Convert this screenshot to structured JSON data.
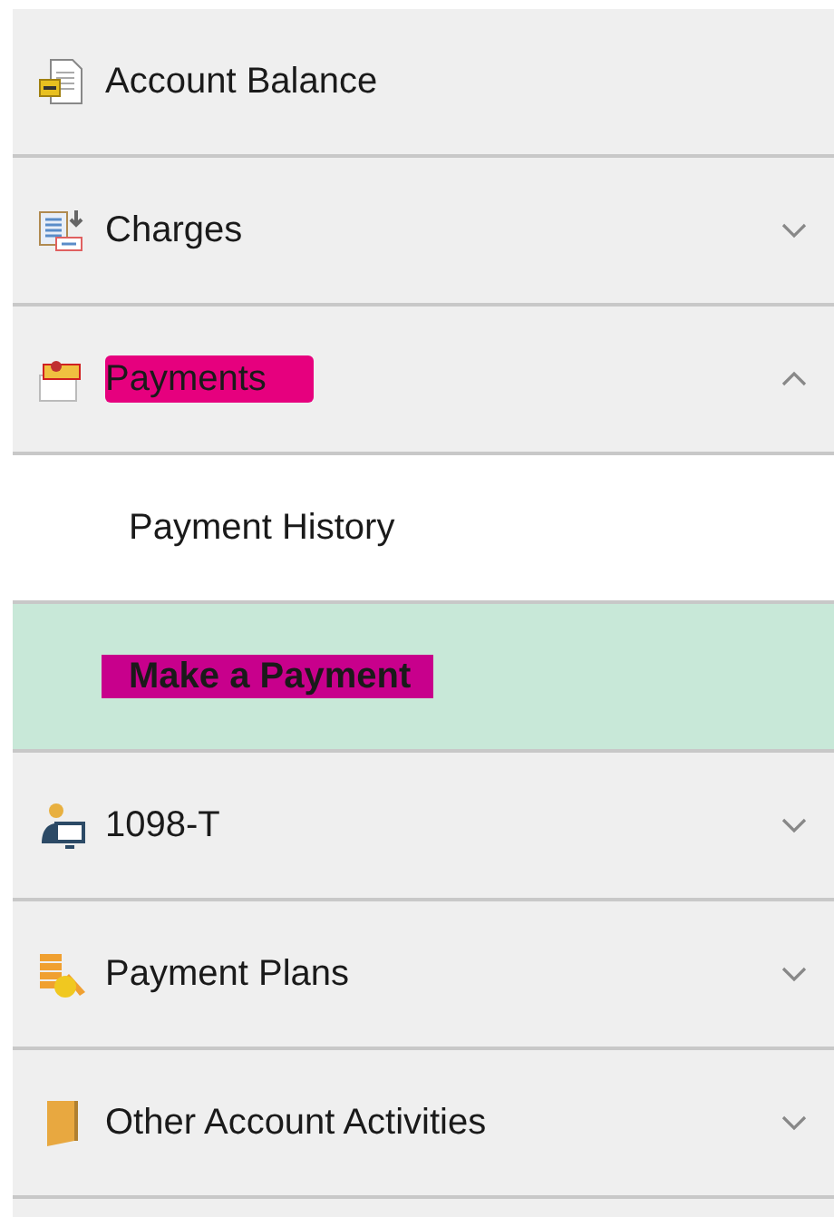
{
  "menu": [
    {
      "label": "Account Balance",
      "highlighted": false
    },
    {
      "label": "Charges",
      "expanded": false,
      "highlighted": false
    },
    {
      "label": "Payments",
      "expanded": true,
      "highlighted": true,
      "children": [
        {
          "label": "Payment History",
          "selected": false,
          "highlighted": false
        },
        {
          "label": "Make a Payment",
          "selected": true,
          "highlighted": true
        }
      ]
    },
    {
      "label": "1098-T",
      "expanded": false,
      "highlighted": false
    },
    {
      "label": "Payment Plans",
      "expanded": false,
      "highlighted": false
    },
    {
      "label": "Other Account Activities",
      "expanded": false,
      "highlighted": false
    }
  ]
}
